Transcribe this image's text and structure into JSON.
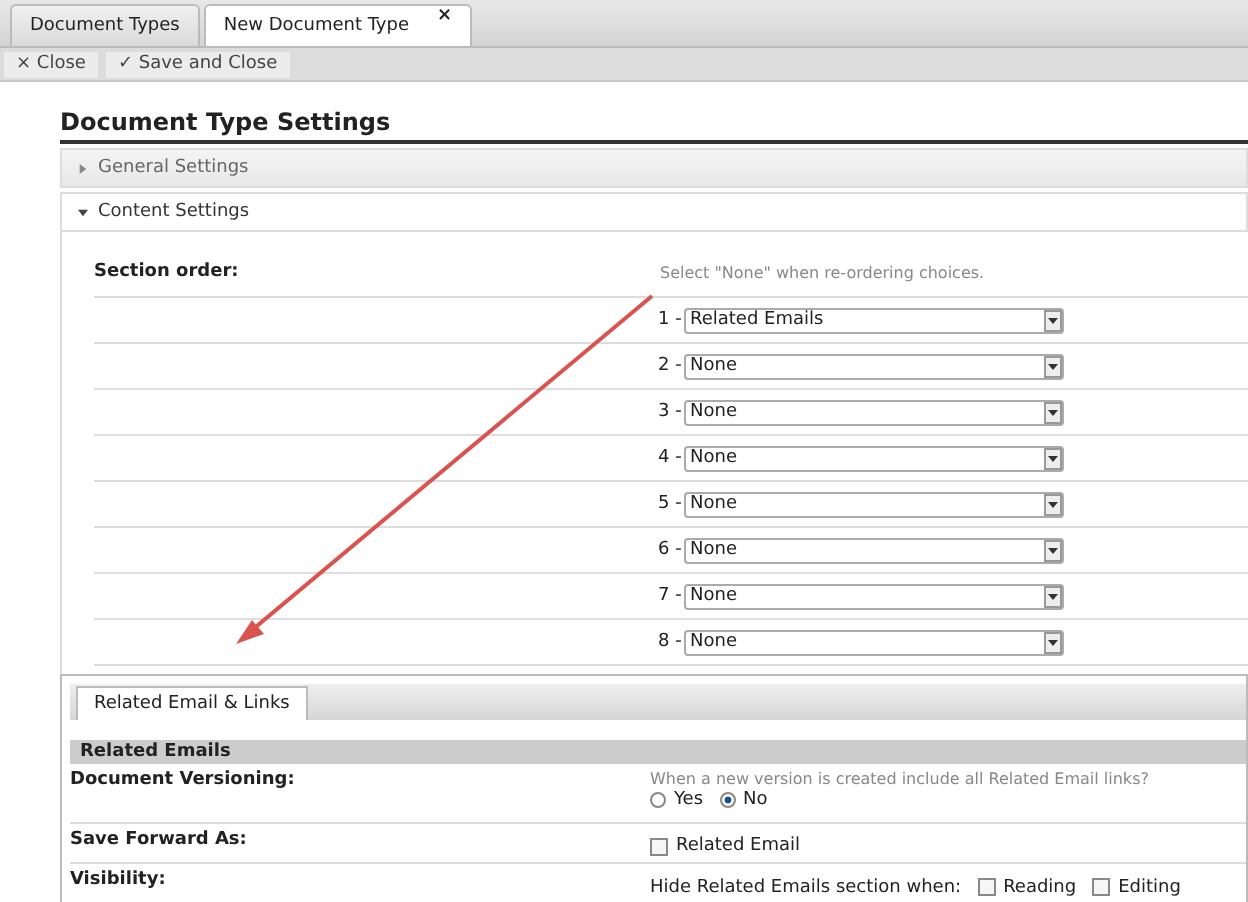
{
  "tabs": [
    {
      "label": "Document Types",
      "selected": false
    },
    {
      "label": "New Document Type",
      "selected": true,
      "close_glyph": "×"
    }
  ],
  "toolbar": [
    {
      "glyph": "×",
      "label": "Close"
    },
    {
      "glyph": "✓",
      "label": "Save and Close"
    }
  ],
  "heading": "Document Type Settings",
  "sections": [
    {
      "label": "General Settings",
      "expanded": false
    },
    {
      "label": "Content Settings",
      "expanded": true
    }
  ],
  "section_order": {
    "label": "Section order:",
    "hint": "Select \"None\" when re-ordering choices.",
    "rows": [
      {
        "number": "1 -",
        "value": "Related Emails"
      },
      {
        "number": "2 -",
        "value": "None"
      },
      {
        "number": "3 -",
        "value": "None"
      },
      {
        "number": "4 -",
        "value": "None"
      },
      {
        "number": "5 -",
        "value": "None"
      },
      {
        "number": "6 -",
        "value": "None"
      },
      {
        "number": "7 -",
        "value": "None"
      },
      {
        "number": "8 -",
        "value": "None"
      }
    ]
  },
  "panel": {
    "tab": "Related Email & Links",
    "header": "Related Emails",
    "versioning": {
      "label": "Document Versioning:",
      "hint": "When a new version is created include all Related Email links?",
      "options": [
        {
          "label": "Yes",
          "selected": false
        },
        {
          "label": "No",
          "selected": true
        }
      ]
    },
    "save_forward": {
      "label": "Save Forward As:",
      "option": {
        "label": "Related Email",
        "checked": false
      }
    },
    "visibility": {
      "label": "Visibility:",
      "prompt": "Hide Related Emails section when:",
      "options": [
        {
          "label": "Reading",
          "checked": false
        },
        {
          "label": "Editing",
          "checked": false
        }
      ]
    }
  }
}
